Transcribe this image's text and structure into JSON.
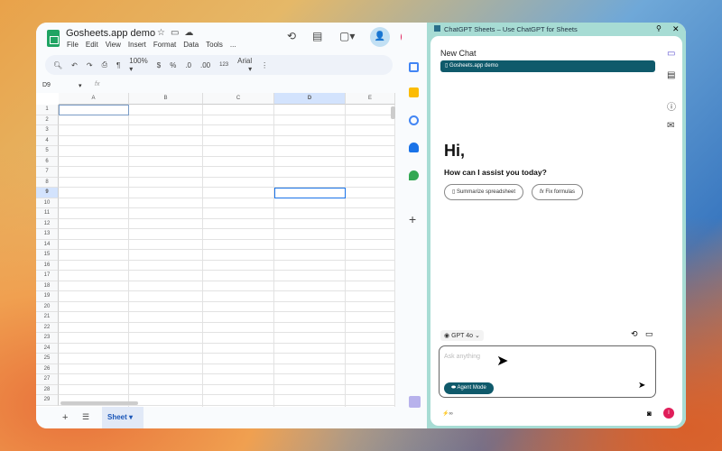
{
  "sheets": {
    "title": "Gosheets.app demo",
    "menu": [
      "File",
      "Edit",
      "View",
      "Insert",
      "Format",
      "Data",
      "Tools",
      "..."
    ],
    "toolbar": {
      "zoom": "100%",
      "currency": "$",
      "percent": "%",
      "dec_decrease": ".0",
      "dec_increase": ".00",
      "number_format": "123",
      "font": "Arial"
    },
    "name_box": "D9",
    "fx": "fx",
    "columns": [
      "A",
      "B",
      "C",
      "D",
      "E"
    ],
    "selected_column": "D",
    "rows": [
      1,
      2,
      3,
      4,
      5,
      6,
      7,
      8,
      9,
      10,
      11,
      12,
      13,
      14,
      15,
      16,
      17,
      18,
      19,
      20,
      21,
      22,
      23,
      24,
      25,
      26,
      27,
      28,
      29
    ],
    "selected_cell": "D9",
    "sheet_tab": "Sheet",
    "avatar": "I"
  },
  "gpt": {
    "window_title": "ChatGPT Sheets – Use ChatGPT for Sheets",
    "new_chat": "New Chat",
    "doc_chip": "Gosheets.app demo",
    "greeting": "Hi,",
    "subtitle": "How can I assist you today?",
    "suggestions": [
      "Summarize spreadsheet",
      "Fix formulas"
    ],
    "model": "GPT 4o",
    "placeholder": "Ask anything",
    "agent_mode": "Agent Mode",
    "credits": "∞",
    "avatar": "I",
    "accent": "#0f5a6b"
  }
}
